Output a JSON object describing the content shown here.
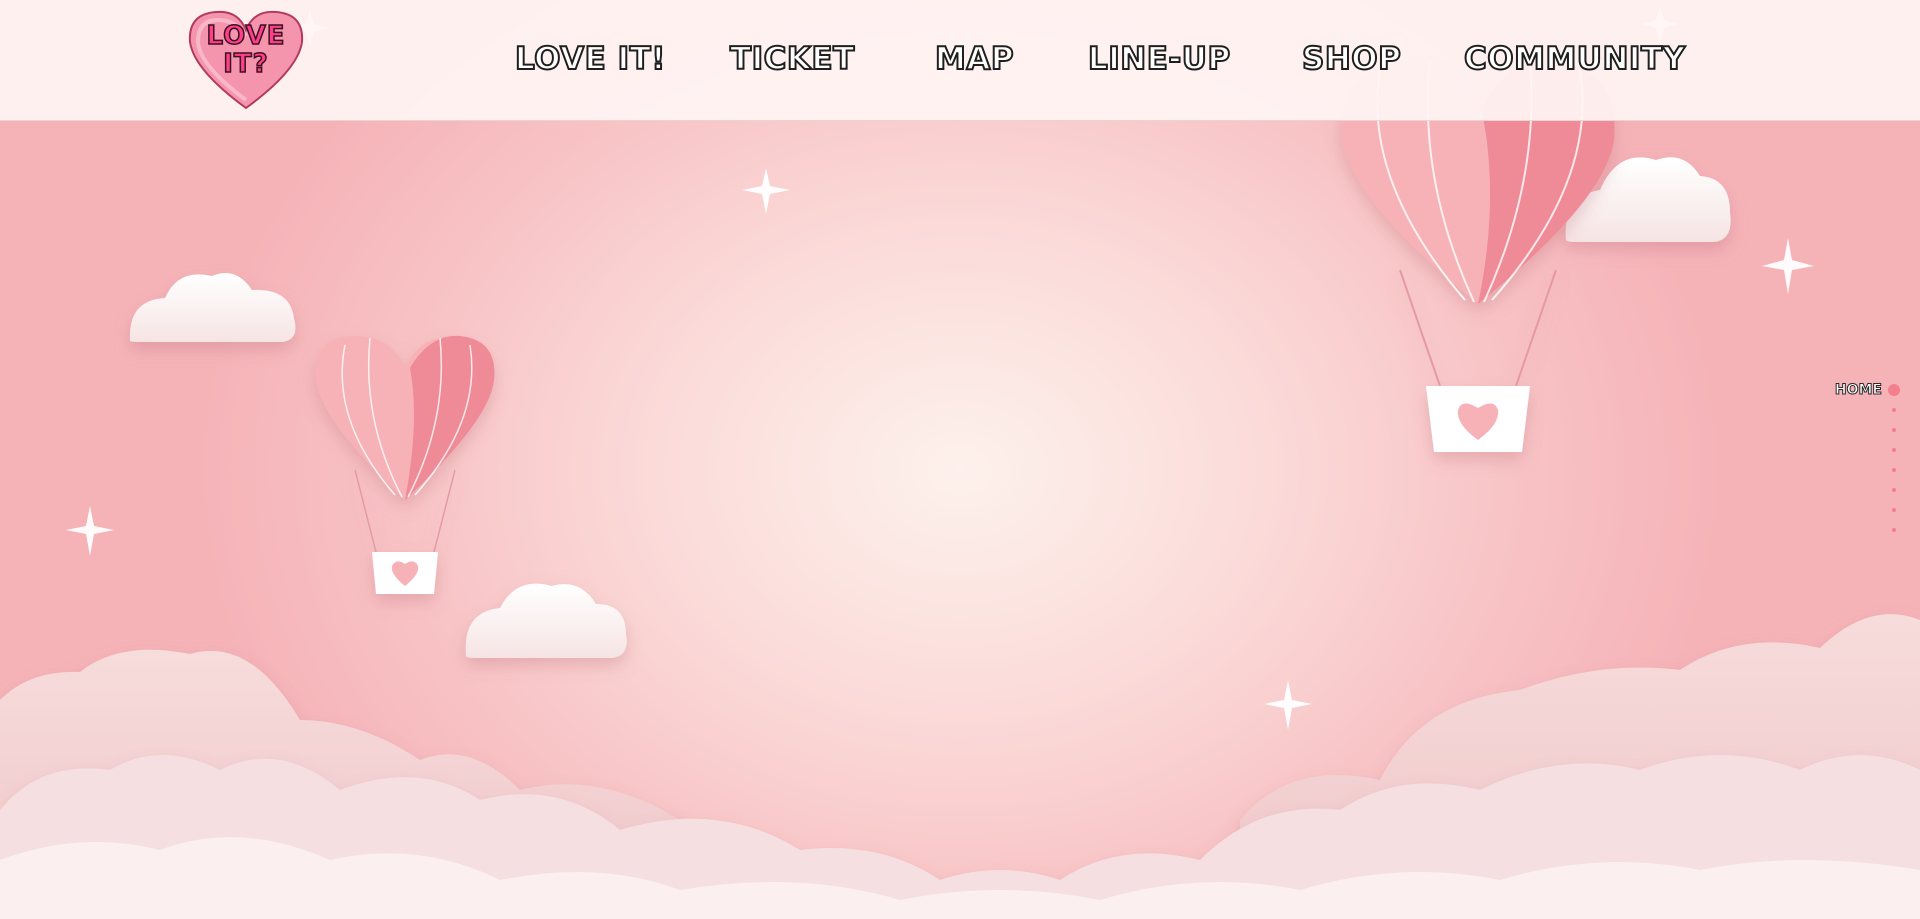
{
  "header": {
    "logo": {
      "text_lines": [
        "LOVE",
        "IT?"
      ],
      "name": "love-it-heart-logo"
    },
    "nav": [
      {
        "id": "love-it",
        "label": "LOVE IT!"
      },
      {
        "id": "ticket",
        "label": "TICKET"
      },
      {
        "id": "map",
        "label": "MAP"
      },
      {
        "id": "line-up",
        "label": "LINE-UP"
      },
      {
        "id": "shop",
        "label": "SHOP"
      },
      {
        "id": "community",
        "label": "COMMUNITY"
      }
    ]
  },
  "section_nav": {
    "active_label": "HOME",
    "dot_count": 7
  },
  "colors": {
    "accent_pink": "#f37f8c",
    "balloon_pink_light": "#f7b2b7",
    "balloon_pink_dark": "#ef8a97",
    "sky_center": "#fdf1ec",
    "sky_edge": "#f5b3b8",
    "cloud_white": "#fdf4f4"
  },
  "scene": {
    "elements": [
      "heart-balloon-icon",
      "heart-balloon-icon",
      "cloud-icon",
      "sparkle-icon"
    ]
  }
}
